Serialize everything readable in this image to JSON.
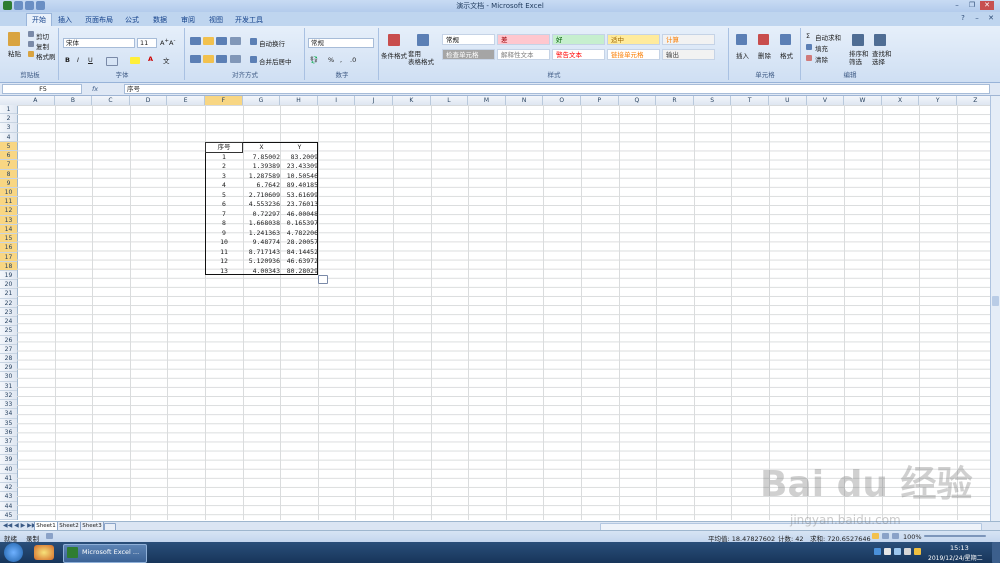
{
  "window": {
    "title": "演示文档 - Microsoft Excel"
  },
  "tabs": [
    "开始",
    "插入",
    "页面布局",
    "公式",
    "数据",
    "审阅",
    "视图",
    "开发工具"
  ],
  "ribbon": {
    "clipboard": {
      "paste": "粘贴",
      "cut": "剪切",
      "copy": "复制",
      "format_painter": "格式刷",
      "label": "剪贴板"
    },
    "font": {
      "name": "宋体",
      "size": "11",
      "label": "字体"
    },
    "alignment": {
      "wrap": "自动换行",
      "merge": "合并后居中",
      "label": "对齐方式"
    },
    "number": {
      "format": "常规",
      "label": "数字"
    },
    "styles": {
      "cond": "条件格式",
      "table": "套用\n表格格式",
      "label": "样式",
      "cells": [
        {
          "text": "常规",
          "bg": "#ffffff",
          "fg": "#000000"
        },
        {
          "text": "差",
          "bg": "#ffc7ce",
          "fg": "#9c0006"
        },
        {
          "text": "好",
          "bg": "#c6efce",
          "fg": "#006100"
        },
        {
          "text": "适中",
          "bg": "#ffeb9c",
          "fg": "#9c6500"
        },
        {
          "text": "计算",
          "bg": "#f2f2f2",
          "fg": "#fa7d00"
        },
        {
          "text": "检查单元格",
          "bg": "#a5a5a5",
          "fg": "#ffffff"
        },
        {
          "text": "解释性文本",
          "bg": "#ffffff",
          "fg": "#7f7f7f"
        },
        {
          "text": "警告文本",
          "bg": "#ffffff",
          "fg": "#ff0000"
        },
        {
          "text": "链接单元格",
          "bg": "#ffffff",
          "fg": "#fa7d00"
        },
        {
          "text": "输出",
          "bg": "#f2f2f2",
          "fg": "#3f3f3f"
        }
      ]
    },
    "cells_group": {
      "insert": "插入",
      "delete": "删除",
      "format": "格式",
      "label": "单元格"
    },
    "editing": {
      "autosum": "自动求和",
      "fill": "填充",
      "clear": "清除",
      "sort": "排序和\n筛选",
      "find": "查找和\n选择",
      "label": "编辑"
    }
  },
  "formula_bar": {
    "name_box": "F5",
    "fx": "fx",
    "content": "序号"
  },
  "columns": [
    "A",
    "B",
    "C",
    "D",
    "E",
    "F",
    "G",
    "H",
    "I",
    "J",
    "K",
    "L",
    "M",
    "N",
    "O",
    "P",
    "Q",
    "R",
    "S",
    "T",
    "U",
    "V",
    "W",
    "X",
    "Y",
    "Z"
  ],
  "rows": [
    "1",
    "2",
    "3",
    "4",
    "5",
    "6",
    "7",
    "8",
    "9",
    "10",
    "11",
    "12",
    "13",
    "14",
    "15",
    "16",
    "17",
    "18",
    "19",
    "20",
    "21",
    "22",
    "23",
    "24",
    "25",
    "26",
    "27",
    "28",
    "29",
    "30",
    "31",
    "32",
    "33",
    "34",
    "35",
    "36",
    "37",
    "38",
    "39",
    "40",
    "41",
    "42",
    "43",
    "44",
    "45"
  ],
  "table": {
    "headers": [
      "序号",
      "X",
      "Y"
    ],
    "rows": [
      [
        "1",
        "7.85002",
        "83.2009"
      ],
      [
        "2",
        "1.39389",
        "23.43309"
      ],
      [
        "3",
        "1.287589",
        "10.50546"
      ],
      [
        "4",
        "6.7642",
        "89.40185"
      ],
      [
        "5",
        "2.710609",
        "53.61699"
      ],
      [
        "6",
        "4.553236",
        "23.76013"
      ],
      [
        "7",
        "0.72297",
        "46.00048"
      ],
      [
        "8",
        "1.668038",
        "0.165397"
      ],
      [
        "9",
        "1.241363",
        "4.782206"
      ],
      [
        "10",
        "9.48774",
        "28.20057"
      ],
      [
        "11",
        "8.717143",
        "84.14452"
      ],
      [
        "12",
        "5.120936",
        "46.63972"
      ],
      [
        "13",
        "4.00343",
        "80.28029"
      ]
    ]
  },
  "sheets": [
    "Sheet1",
    "Sheet2",
    "Sheet3"
  ],
  "status": {
    "mode": "就绪",
    "macro": "录制",
    "average": "平均值: 18.47827602",
    "count": "计数: 42",
    "sum": "求和: 720.6527646",
    "zoom": "100%"
  },
  "taskbar": {
    "app": "Microsoft Excel ...",
    "time": "15:13",
    "date": "2019/12/24/星期二"
  },
  "watermark": {
    "logo": "Bai du 经验",
    "url": "jingyan.baidu.com"
  }
}
